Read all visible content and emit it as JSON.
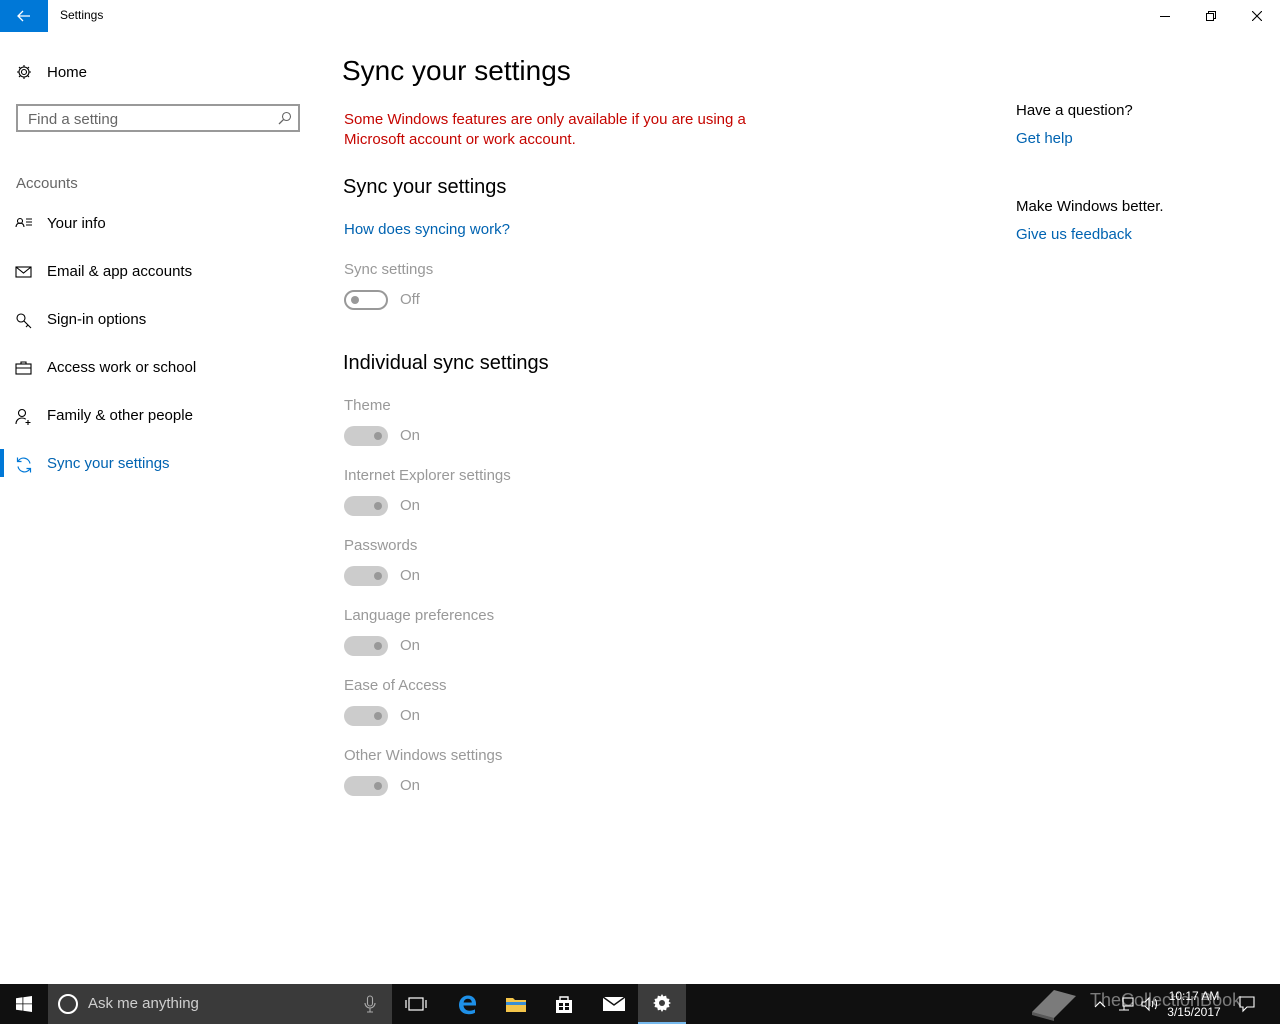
{
  "window": {
    "title": "Settings"
  },
  "nav": {
    "home_label": "Home",
    "search_placeholder": "Find a setting",
    "group_label": "Accounts",
    "items": [
      {
        "label": "Your info"
      },
      {
        "label": "Email & app accounts"
      },
      {
        "label": "Sign-in options"
      },
      {
        "label": "Access work or school"
      },
      {
        "label": "Family & other people"
      },
      {
        "label": "Sync your settings",
        "active": true
      }
    ]
  },
  "main": {
    "title": "Sync your settings",
    "warning": "Some Windows features are only available if you are using a Microsoft account or work account.",
    "sync_section_heading": "Sync your settings",
    "how_link": "How does syncing work?",
    "sync_settings": {
      "label": "Sync settings",
      "state": "Off"
    },
    "individual_heading": "Individual sync settings",
    "individual": [
      {
        "label": "Theme",
        "state": "On"
      },
      {
        "label": "Internet Explorer settings",
        "state": "On"
      },
      {
        "label": "Passwords",
        "state": "On"
      },
      {
        "label": "Language preferences",
        "state": "On"
      },
      {
        "label": "Ease of Access",
        "state": "On"
      },
      {
        "label": "Other Windows settings",
        "state": "On"
      }
    ]
  },
  "rail": {
    "question_heading": "Have a question?",
    "get_help": "Get help",
    "better_heading": "Make Windows better.",
    "feedback": "Give us feedback"
  },
  "taskbar": {
    "search_placeholder": "Ask me anything",
    "time": "10:17 AM",
    "date": "3/15/2017",
    "watermark": "TheCollectionBook"
  },
  "colors": {
    "accent": "#0078d7",
    "link": "#0063b1",
    "warning": "#c50500",
    "disabled": "#999999"
  }
}
